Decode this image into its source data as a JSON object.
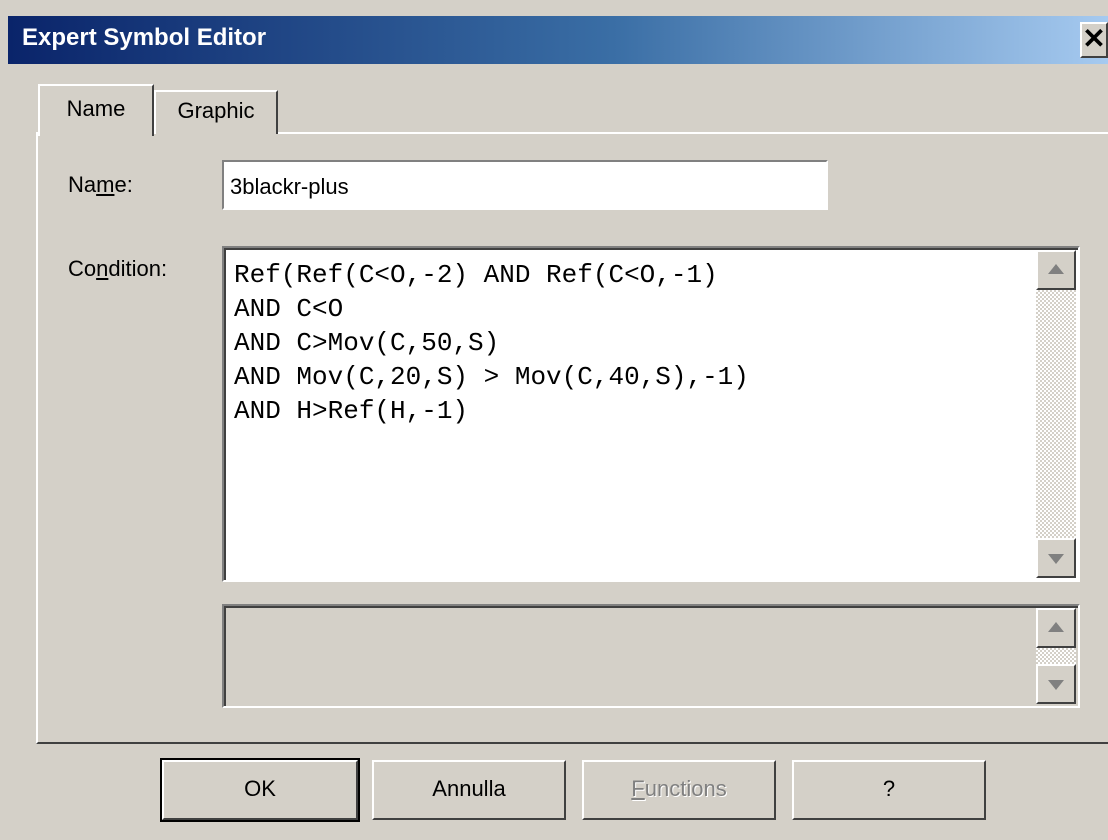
{
  "window": {
    "title": "Expert Symbol Editor",
    "close_glyph": "✕"
  },
  "tabs": [
    {
      "label": "Name",
      "active": true
    },
    {
      "label": "Graphic",
      "active": false
    }
  ],
  "form": {
    "name_label_pre": "Na",
    "name_label_u": "m",
    "name_label_post": "e:",
    "name_value": "3blackr-plus",
    "condition_label_pre": "Co",
    "condition_label_u": "n",
    "condition_label_post": "dition:",
    "condition_value": "Ref(Ref(C<O,-2) AND Ref(C<O,-1)\nAND C<O\nAND C>Mov(C,50,S)\nAND Mov(C,20,S) > Mov(C,40,S),-1)\nAND H>Ref(H,-1)",
    "output_value": ""
  },
  "buttons": {
    "ok": "OK",
    "annulla": "Annulla",
    "functions_u": "F",
    "functions_rest": "unctions",
    "help": "?"
  },
  "icons": {
    "scroll_up": "scroll-up-arrow-icon",
    "scroll_down": "scroll-down-arrow-icon",
    "close": "close-icon"
  },
  "colors": {
    "titlebar_start": "#0a246a",
    "titlebar_end": "#a6caf0",
    "face": "#d4d0c8"
  }
}
